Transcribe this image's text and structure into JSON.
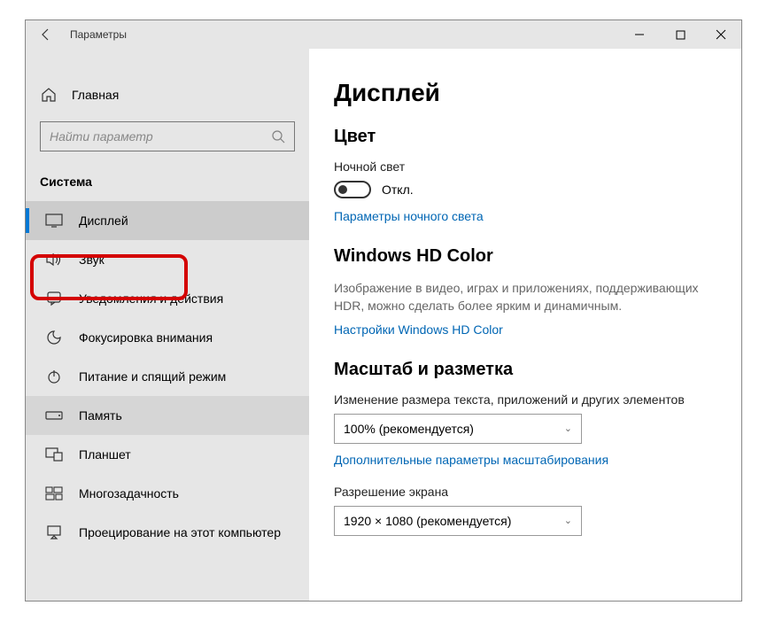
{
  "titlebar": {
    "title": "Параметры"
  },
  "sidebar": {
    "home_label": "Главная",
    "search_placeholder": "Найти параметр",
    "category_label": "Система",
    "items": [
      {
        "label": "Дисплей"
      },
      {
        "label": "Звук"
      },
      {
        "label": "Уведомления и действия"
      },
      {
        "label": "Фокусировка внимания"
      },
      {
        "label": "Питание и спящий режим"
      },
      {
        "label": "Память"
      },
      {
        "label": "Планшет"
      },
      {
        "label": "Многозадачность"
      },
      {
        "label": "Проецирование на этот компьютер"
      }
    ]
  },
  "content": {
    "title": "Дисплей",
    "color": {
      "heading": "Цвет",
      "nightlight_label": "Ночной свет",
      "toggle_state": "Откл.",
      "nightlight_link": "Параметры ночного света"
    },
    "hd": {
      "heading": "Windows HD Color",
      "desc": "Изображение в видео, играх и приложениях, поддерживающих HDR, можно сделать более ярким и динамичным.",
      "link": "Настройки Windows HD Color"
    },
    "scale": {
      "heading": "Масштаб и разметка",
      "scale_label": "Изменение размера текста, приложений и других элементов",
      "scale_value": "100% (рекомендуется)",
      "advanced_link": "Дополнительные параметры масштабирования",
      "resolution_label": "Разрешение экрана",
      "resolution_value": "1920 × 1080 (рекомендуется)"
    }
  }
}
